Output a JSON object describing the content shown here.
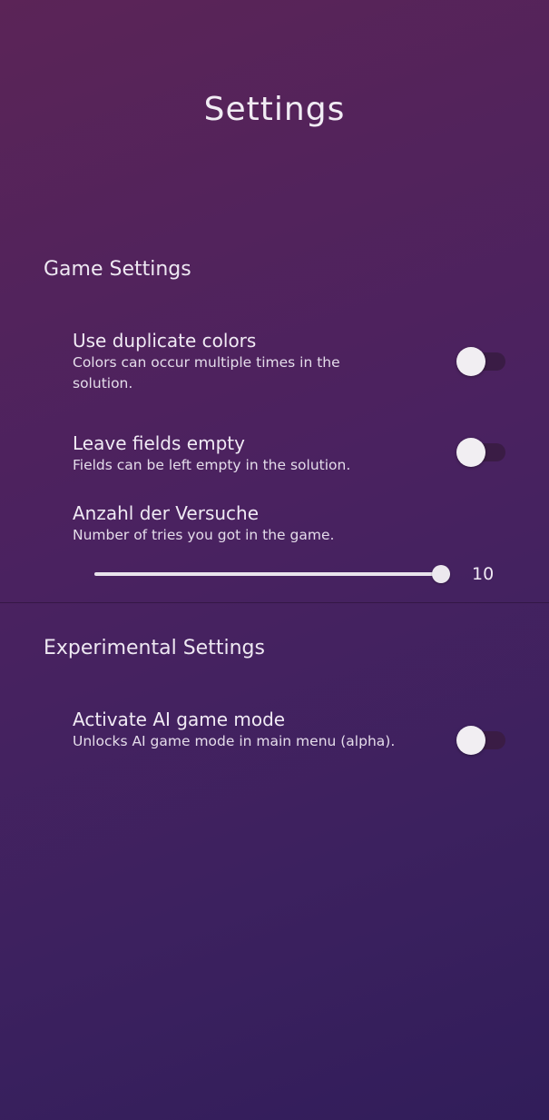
{
  "header": {
    "title": "Settings"
  },
  "game_settings": {
    "section_title": "Game Settings",
    "duplicate_colors": {
      "title": "Use duplicate colors",
      "description": "Colors can occur multiple times in the solution.",
      "enabled": false
    },
    "empty_fields": {
      "title": "Leave fields empty",
      "description": "Fields can be left empty in the solution.",
      "enabled": false
    },
    "tries": {
      "title": "Anzahl der Versuche",
      "description": "Number of tries you got in the game.",
      "value": "10",
      "slider_fraction": 1.0
    }
  },
  "experimental_settings": {
    "section_title": "Experimental Settings",
    "ai_mode": {
      "title": "Activate AI game mode",
      "description": "Unlocks AI game mode in main menu (alpha).",
      "enabled": false
    }
  },
  "colors": {
    "background_top": "#5b2457",
    "background_bottom": "#311d5a",
    "toggle_track_off": "#3a1c45",
    "toggle_thumb": "#f1eef2",
    "text": "#ece6f0"
  }
}
